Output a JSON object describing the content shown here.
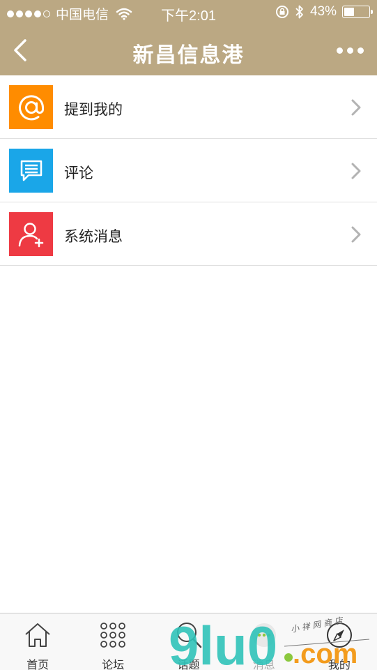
{
  "status_bar": {
    "carrier": "中国电信",
    "time": "下午2:01",
    "battery_percent": "43%",
    "battery_level": 0.43
  },
  "nav": {
    "title": "新昌信息港",
    "back_icon": "chevron-left-icon",
    "more_icon": "more-dots-icon"
  },
  "list": {
    "items": [
      {
        "label": "提到我的",
        "icon": "at-sign-icon",
        "color": "#ff8c00"
      },
      {
        "label": "评论",
        "icon": "comment-icon",
        "color": "#1aa6e8"
      },
      {
        "label": "系统消息",
        "icon": "user-add-icon",
        "color": "#ee3a43"
      }
    ]
  },
  "tab_bar": {
    "tabs": [
      {
        "label": "首页",
        "icon": "home-icon"
      },
      {
        "label": "论坛",
        "icon": "grid-icon"
      },
      {
        "label": "话题",
        "icon": "search-icon"
      },
      {
        "label": "消息",
        "icon": "message-icon"
      },
      {
        "label": "我的",
        "icon": "compass-icon"
      }
    ]
  },
  "watermark": {
    "brand": "9lu0",
    "domain": ".com",
    "tagline": "小 祥 网 商 店"
  },
  "colors": {
    "header": "#bba883",
    "watermark_teal": "#2fc2b8",
    "watermark_orange": "#f39c1e",
    "watermark_green": "#8bc83e"
  }
}
